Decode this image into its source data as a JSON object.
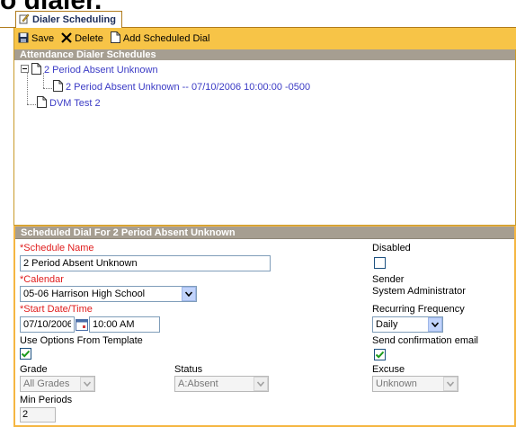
{
  "page_heading_fragment": "o dialer.",
  "tab": {
    "label": "Dialer Scheduling"
  },
  "toolbar": {
    "save_label": "Save",
    "delete_label": "Delete",
    "add_label": "Add Scheduled Dial"
  },
  "schedules": {
    "header": "Attendance Dialer Schedules",
    "items": [
      {
        "label": "2 Period Absent Unknown"
      },
      {
        "label": "2 Period Absent Unknown -- 07/10/2006 10:00:00 -0500"
      },
      {
        "label": "DVM Test 2"
      }
    ]
  },
  "detail": {
    "header": "Scheduled Dial For 2 Period Absent Unknown",
    "schedule_name": {
      "label": "*Schedule Name",
      "value": "2 Period Absent Unknown"
    },
    "calendar": {
      "label": "*Calendar",
      "value": "05-06 Harrison High School"
    },
    "start": {
      "label": "*Start Date/Time",
      "date": "07/10/2006",
      "time": "10:00 AM"
    },
    "use_template": {
      "label": "Use Options From Template",
      "checked": true
    },
    "grade": {
      "label": "Grade",
      "value": "All Grades"
    },
    "status": {
      "label": "Status",
      "value": "A:Absent"
    },
    "min_periods": {
      "label": "Min Periods",
      "value": "2"
    },
    "disabled": {
      "label": "Disabled",
      "checked": false
    },
    "sender": {
      "label": "Sender",
      "value": "System Administrator"
    },
    "recurring": {
      "label": "Recurring Frequency",
      "value": "Daily"
    },
    "send_email": {
      "label": "Send confirmation email",
      "checked": true
    },
    "excuse": {
      "label": "Excuse",
      "value": "Unknown"
    }
  }
}
